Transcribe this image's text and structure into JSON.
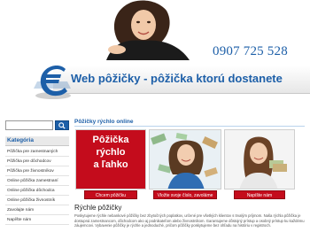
{
  "header": {
    "phone": "0907 725 528",
    "site_title": "Web pôžičky - pôžička ktorú dostanete",
    "colors": {
      "brand_blue": "#1d5fa8",
      "promo_red": "#c40c1c"
    }
  },
  "sidebar": {
    "search_placeholder": "",
    "category_heading": "Kategória",
    "items": [
      {
        "label": "Pôžička pre zamestnaných"
      },
      {
        "label": "Pôžička pre dôchodcov"
      },
      {
        "label": "Pôžička pre živnostníkov"
      },
      {
        "label": "Online pôžička zamestnaní"
      },
      {
        "label": "Online pôžička dôchodca"
      },
      {
        "label": "Online pôžička živnostník"
      },
      {
        "label": "Zavolajte nám"
      },
      {
        "label": "Napíšte nám"
      }
    ]
  },
  "main": {
    "title": "Pôžičky rýchlo online",
    "promo_lines": [
      "Pôžička",
      "rýchlo",
      "a ľahko"
    ],
    "buttons": [
      {
        "label": "Chcem pôžičku"
      },
      {
        "label": "Vložte svoje číslo, zavoláme"
      },
      {
        "label": "Napíšte nám"
      }
    ],
    "subtitle": "Rýchle pôžičky",
    "paragraph": "Poskytujeme rýchle nebankové pôžičky bez zbytočných poplatkov, určené pre všetkých klientov s trvalým príjmom. Naša rýchla pôžička je dostupná zamestnancom, dôchodcom ako aj podnikateľom alebo živnostníkom. Garantujeme dôstojný prístup a osobný prístup ku každému záujemcovi. Vybavenie pôžičky je rýchle a jednoduché, pričom pôžičky poskytujeme bez ohľadu na históriu v registroch."
  }
}
